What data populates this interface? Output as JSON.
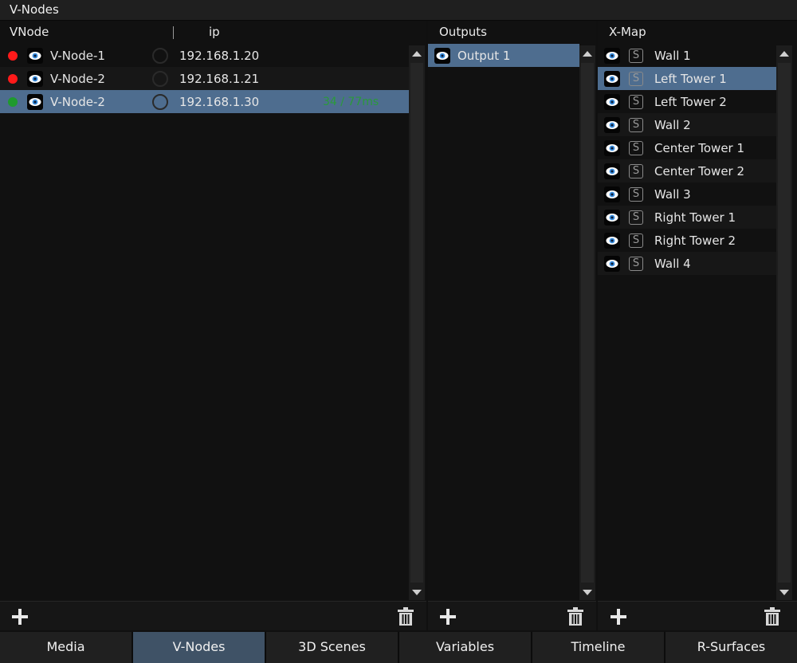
{
  "window": {
    "title": "V-Nodes"
  },
  "vnodes": {
    "headers": {
      "name": "VNode",
      "ip": "ip"
    },
    "rows": [
      {
        "name": "V-Node-1",
        "ip": "192.168.1.20",
        "latency": "",
        "status_color": "#ff1a1a",
        "selected": false
      },
      {
        "name": "V-Node-2",
        "ip": "192.168.1.21",
        "latency": "",
        "status_color": "#ff1a1a",
        "selected": false
      },
      {
        "name": "V-Node-2",
        "ip": "192.168.1.30",
        "latency": "34 / 77ms",
        "status_color": "#1f9a2e",
        "selected": true
      }
    ]
  },
  "outputs": {
    "header": "Outputs",
    "rows": [
      {
        "label": "Output 1",
        "selected": true
      }
    ]
  },
  "xmap": {
    "header": "X-Map",
    "solo_glyph": "S",
    "rows": [
      {
        "label": "Wall 1",
        "selected": false
      },
      {
        "label": "Left Tower 1",
        "selected": true
      },
      {
        "label": "Left Tower 2",
        "selected": false
      },
      {
        "label": "Wall 2",
        "selected": false
      },
      {
        "label": "Center Tower 1",
        "selected": false
      },
      {
        "label": "Center Tower 2",
        "selected": false
      },
      {
        "label": "Wall 3",
        "selected": false
      },
      {
        "label": "Right Tower 1",
        "selected": false
      },
      {
        "label": "Right Tower 2",
        "selected": false
      },
      {
        "label": "Wall 4",
        "selected": false
      }
    ]
  },
  "toolbar_icons": {
    "add": "plus-icon",
    "delete": "trash-icon"
  },
  "tabs": [
    {
      "label": "Media",
      "active": false
    },
    {
      "label": "V-Nodes",
      "active": true
    },
    {
      "label": "3D Scenes",
      "active": false
    },
    {
      "label": "Variables",
      "active": false
    },
    {
      "label": "Timeline",
      "active": false
    },
    {
      "label": "R-Surfaces",
      "active": false
    }
  ],
  "colors": {
    "selection": "#4e6d8f",
    "active_tab": "#3f5266",
    "latency_text": "#2a9a3a",
    "eye_iris": "#3b8fe0"
  }
}
